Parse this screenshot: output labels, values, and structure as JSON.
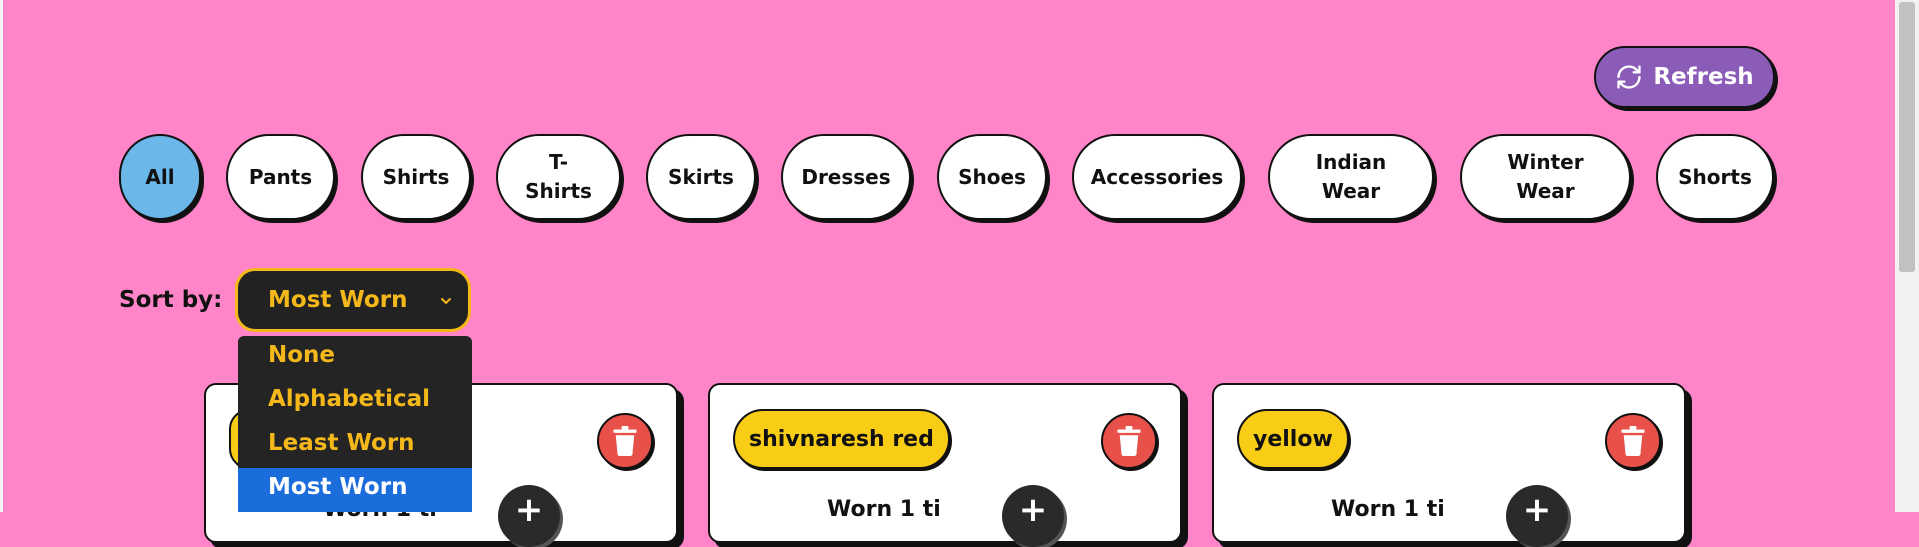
{
  "toolbar": {
    "refresh_label": "Refresh",
    "refresh_icon": "refresh-icon"
  },
  "categories": [
    "All",
    "Pants",
    "Shirts",
    "T-Shirts",
    "Skirts",
    "Dresses",
    "Shoes",
    "Accessories",
    "Indian Wear",
    "Winter Wear",
    "Shorts"
  ],
  "active_category": "All",
  "sort": {
    "label": "Sort by:",
    "selected": "Most Worn",
    "options": [
      "None",
      "Alphabetical",
      "Least Worn",
      "Most Worn"
    ]
  },
  "cards": [
    {
      "name": "",
      "worn_text": "Worn 1 ti"
    },
    {
      "name": "shivnaresh red",
      "worn_text": "Worn 1 ti"
    },
    {
      "name": "yellow",
      "worn_text": "Worn 1 ti"
    }
  ],
  "colors": {
    "background": "#ff85c8",
    "accent_purple": "#8a5cb8",
    "active_blue": "#6bb7ea",
    "tag_yellow": "#f9cc16",
    "delete_red": "#e8504a",
    "select_gold": "#f5b81a",
    "option_highlight": "#1c6ddc"
  }
}
